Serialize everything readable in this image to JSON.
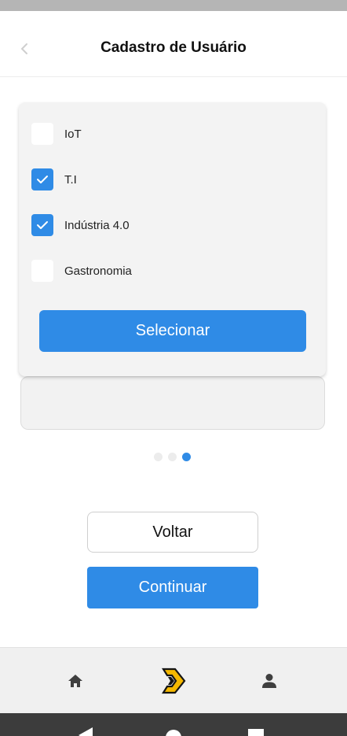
{
  "header": {
    "title": "Cadastro de Usuário",
    "back_icon": "chevron-left-icon"
  },
  "dropdown": {
    "options": [
      {
        "label": "IoT",
        "checked": false
      },
      {
        "label": "T.I",
        "checked": true
      },
      {
        "label": "Indústria 4.0",
        "checked": true
      },
      {
        "label": "Gastronomia",
        "checked": false
      }
    ],
    "select_label": "Selecionar"
  },
  "pager": {
    "total": 3,
    "active": 3
  },
  "actions": {
    "back_label": "Voltar",
    "continue_label": "Continuar"
  },
  "bottom_nav": {
    "items": [
      "home-icon",
      "app-logo",
      "profile-icon"
    ]
  },
  "colors": {
    "accent": "#2f8be6",
    "logo_yellow": "#f5b800"
  }
}
